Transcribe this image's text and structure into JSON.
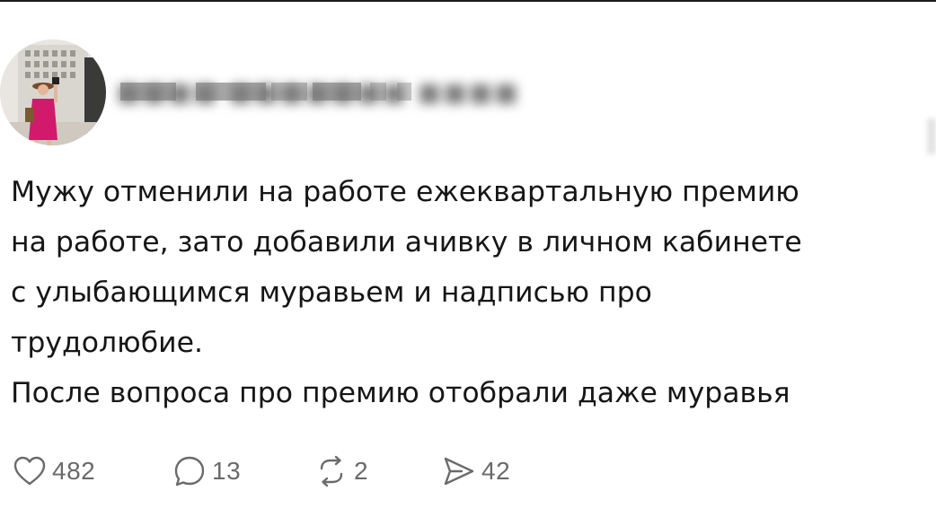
{
  "post": {
    "author_name_obscured": "■■■■ ■■■■■■■ ■■■■",
    "text_lines": [
      "Мужу отменили на работе ежеквартальную премию",
      "на работе, зато добавили ачивку в личном кабинете",
      "с улыбающимся муравьем и надписью про",
      "трудолюбие.",
      "После вопроса про премию отобрали даже муравья"
    ]
  },
  "actions": {
    "likes": "482",
    "replies": "13",
    "reposts": "2",
    "shares": "42"
  },
  "icons": {
    "like": "heart-icon",
    "reply": "speech-bubble-icon",
    "repost": "repost-arrows-icon",
    "share": "send-icon"
  },
  "colors": {
    "text": "#161616",
    "icon": "#6a6a6a",
    "avatar_dress": "#d11a6b"
  }
}
